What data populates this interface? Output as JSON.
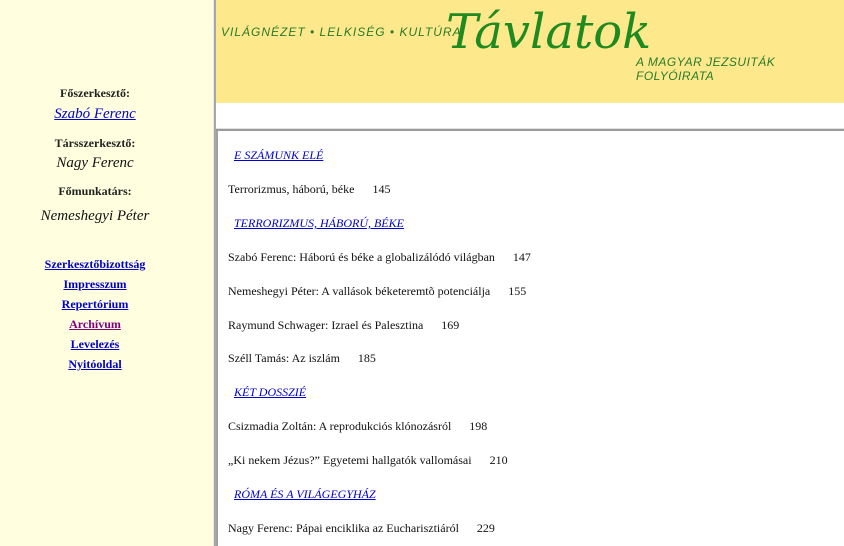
{
  "sidebar": {
    "editor_label": "Főszerkesztő:",
    "editor_name": "Szabó Ferenc",
    "coeditor_label": "Társszerkesztő:",
    "coeditor_name": "Nagy Ferenc",
    "collaborator_label": "Főmunkatárs:",
    "collaborator_name": "Nemeshegyi Péter",
    "links": [
      "Szerkesztőbizottság",
      "Impresszum",
      "Repertórium",
      "Archívum",
      "Levelezés",
      "Nyitóoldal"
    ]
  },
  "header": {
    "tagline": "VILÁGNÉZET • LELKISÉG • KULTÚRA",
    "logo": "Távlatok",
    "subtitle": "A MAGYAR JEZSUITÁK FOLYÓIRATA"
  },
  "main": {
    "items": [
      {
        "type": "section",
        "text": "E SZÁMUNK ELÉ"
      },
      {
        "type": "entry",
        "text": "Terrorizmus, háború, béke",
        "page": "145"
      },
      {
        "type": "section",
        "text": "TERRORIZMUS, HÁBORÚ, BÉKE"
      },
      {
        "type": "entry",
        "text": "Szabó Ferenc: Háború és béke a globalizálódó világban",
        "page": "147"
      },
      {
        "type": "entry",
        "text": "Nemeshegyi Péter: A vallások béketeremtõ potenciálja",
        "page": "155"
      },
      {
        "type": "entry",
        "text": "Raymund Schwager: Izrael és Palesztina",
        "page": "169"
      },
      {
        "type": "entry",
        "text": "Széll Tamás: Az iszlám",
        "page": "185"
      },
      {
        "type": "section",
        "text": "KÉT DOSSZIÉ"
      },
      {
        "type": "entry",
        "text": "Csizmadia Zoltán: A reprodukciós klónozásról",
        "page": "198"
      },
      {
        "type": "entry",
        "text": "„Ki nekem Jézus?” Egyetemi hallgatók vallomásai",
        "page": "210"
      },
      {
        "type": "section",
        "text": "RÓMA ÉS A VILÁGEGYHÁZ"
      },
      {
        "type": "entry",
        "text": "Nagy Ferenc: Pápai enciklika az Eucharisztiáról",
        "page": "229"
      }
    ]
  }
}
